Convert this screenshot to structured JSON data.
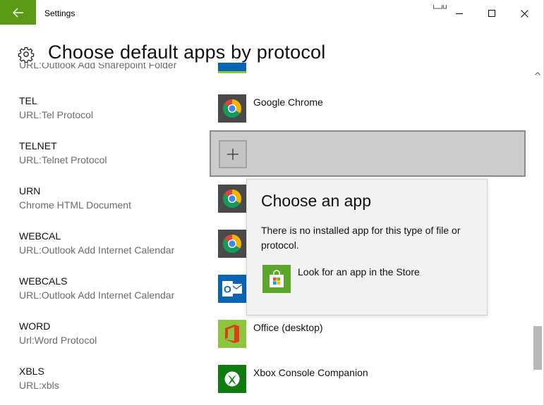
{
  "window": {
    "title": "Settings",
    "accent_color": "#5b9a17"
  },
  "header": {
    "title": "Choose default apps by protocol",
    "icon": "gear-icon"
  },
  "rows": [
    {
      "name": "",
      "desc": "URL:Outlook Add Sharepoint Folder",
      "app": "",
      "icon": "outlook-icon"
    },
    {
      "name": "TEL",
      "desc": "URL:Tel Protocol",
      "app": "Google Chrome",
      "icon": "chrome-icon"
    },
    {
      "name": "TELNET",
      "desc": "URL:Telnet Protocol",
      "app": "",
      "icon": "plus-icon"
    },
    {
      "name": "URN",
      "desc": "Chrome HTML Document",
      "app": "",
      "icon": "chrome-icon"
    },
    {
      "name": "WEBCAL",
      "desc": "URL:Outlook Add Internet Calendar",
      "app": "",
      "icon": "chrome-icon"
    },
    {
      "name": "WEBCALS",
      "desc": "URL:Outlook Add Internet Calendar",
      "app": "",
      "icon": "outlook-icon"
    },
    {
      "name": "WORD",
      "desc": "Url:Word Protocol",
      "app": "Office (desktop)",
      "icon": "office-icon"
    },
    {
      "name": "XBLS",
      "desc": "URL:xbls",
      "app": "Xbox Console Companion",
      "icon": "xbox-icon"
    }
  ],
  "flyout": {
    "title": "Choose an app",
    "message": "There is no installed app for this type of file or protocol.",
    "store_link": "Look for an app in the Store",
    "store_icon": "store-icon"
  },
  "colors": {
    "tile_dark": "#4a4a4a",
    "outlook_blue": "#0a64b4",
    "office_orange": "#dc3e15",
    "xbox_green": "#107c10",
    "store_green": "#5ea52c",
    "selection_gray": "#cccccc"
  }
}
